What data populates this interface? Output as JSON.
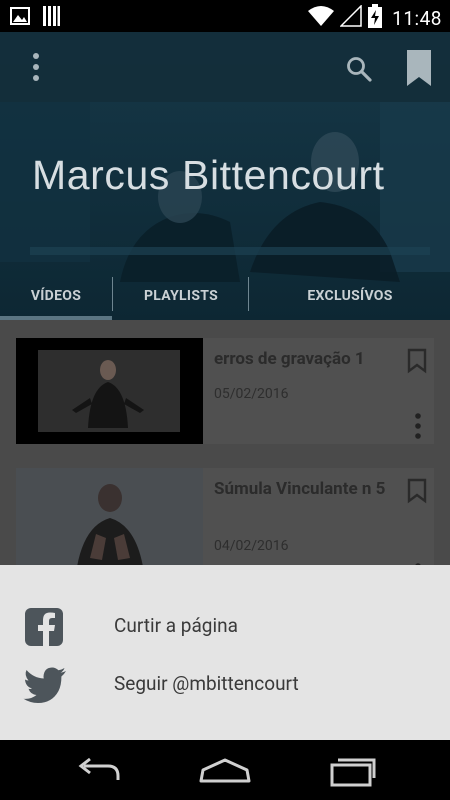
{
  "status_bar": {
    "time": "11:48",
    "icons": [
      "image-icon",
      "sd-card-icon",
      "wifi-icon",
      "signal-icon",
      "battery-charging-icon"
    ]
  },
  "toolbar": {
    "menu_icon": "vertical-dots-icon",
    "search_icon": "search-icon",
    "bookmark_icon": "bookmark-icon"
  },
  "channel": {
    "title": "Marcus Bittencourt"
  },
  "tabs": [
    {
      "label": "VÍDEOS",
      "active": true
    },
    {
      "label": "PLAYLISTS",
      "active": false
    },
    {
      "label": "EXCLUSÍVOS",
      "active": false
    }
  ],
  "videos": [
    {
      "title": "erros de gravação 1",
      "date": "05/02/2016"
    },
    {
      "title": "Súmula Vinculante n 5",
      "date": "04/02/2016"
    }
  ],
  "share_sheet": {
    "items": [
      {
        "icon": "facebook-icon",
        "label": "Curtir a página"
      },
      {
        "icon": "twitter-icon",
        "label": "Seguir @mbittencourt"
      }
    ]
  },
  "nav_bar": {
    "buttons": [
      "back-icon",
      "home-icon",
      "recent-apps-icon"
    ]
  },
  "colors": {
    "toolbar": "#142e3a",
    "sheet_background": "#e4e4e4",
    "list_background": "#4a4a4a"
  }
}
